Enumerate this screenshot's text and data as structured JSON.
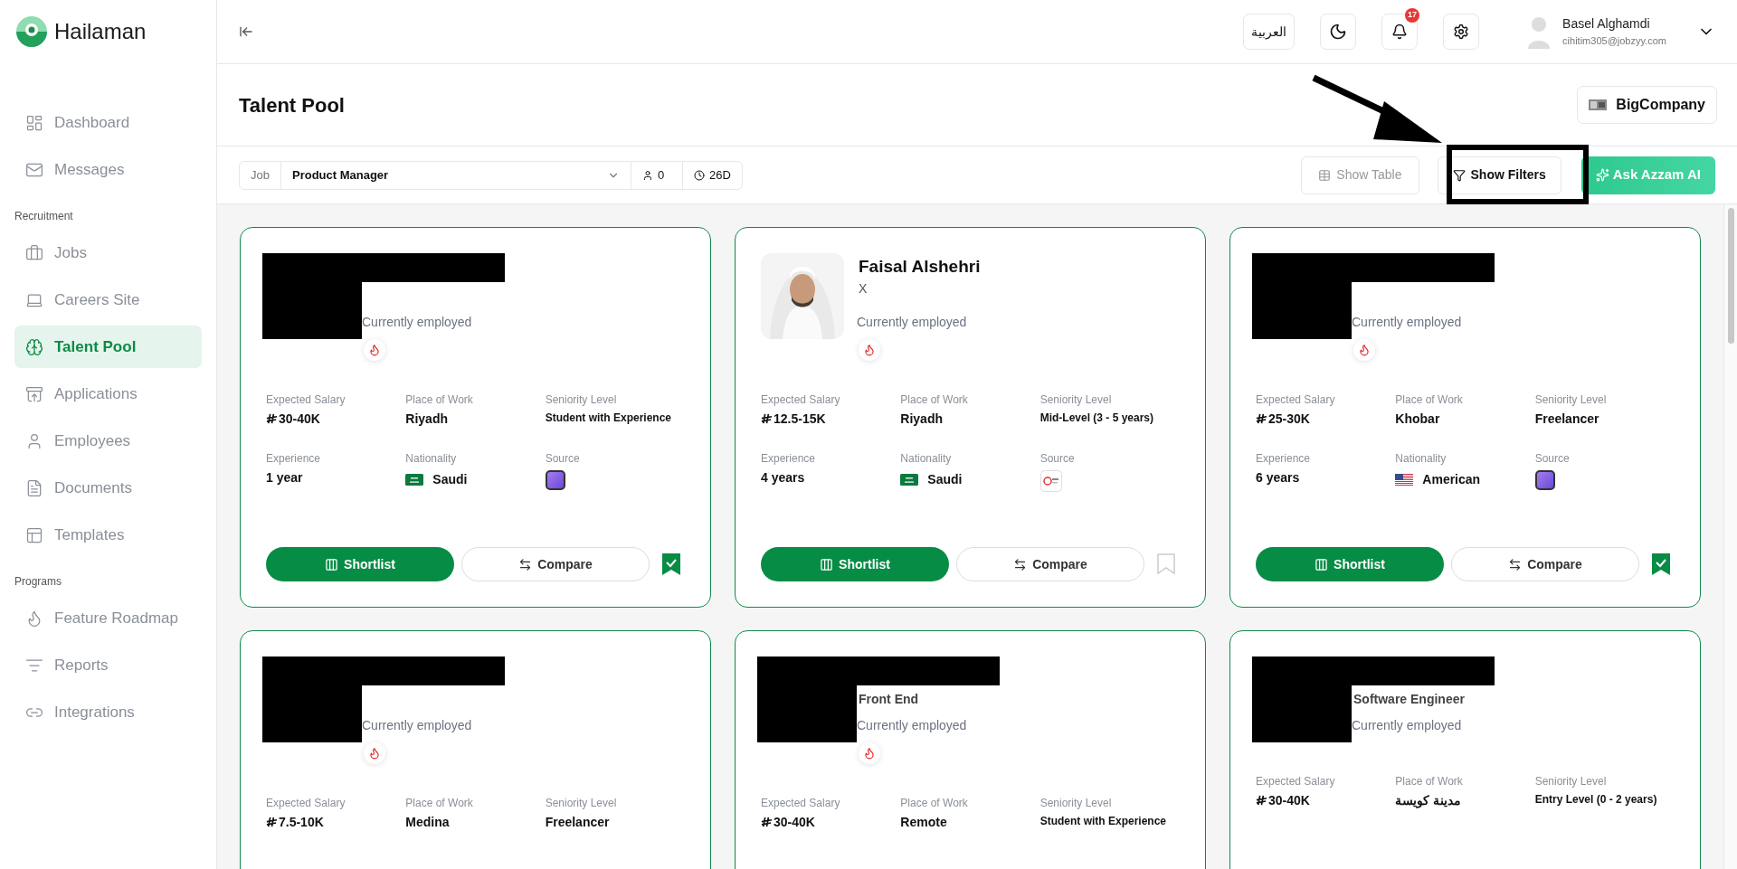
{
  "brand": {
    "name": "Hailaman"
  },
  "sidebar": {
    "sections": [
      {
        "items": [
          {
            "label": "Dashboard",
            "selected": false
          },
          {
            "label": "Messages",
            "selected": false
          }
        ]
      },
      {
        "title": "Recruitment",
        "items": [
          {
            "label": "Jobs",
            "selected": false
          },
          {
            "label": "Careers Site",
            "selected": false
          },
          {
            "label": "Talent Pool",
            "selected": true
          },
          {
            "label": "Applications",
            "selected": false
          },
          {
            "label": "Employees",
            "selected": false
          },
          {
            "label": "Documents",
            "selected": false
          },
          {
            "label": "Templates",
            "selected": false
          }
        ]
      },
      {
        "title": "Programs",
        "items": [
          {
            "label": "Feature Roadmap",
            "selected": false
          },
          {
            "label": "Reports",
            "selected": false
          },
          {
            "label": "Integrations",
            "selected": false
          }
        ]
      }
    ]
  },
  "header": {
    "language": "العربية",
    "notifications": "17",
    "user": {
      "name": "Basel Alghamdi",
      "email": "cihitim305@jobzyy.com"
    }
  },
  "page": {
    "title": "Talent Pool",
    "company": "BigCompany"
  },
  "filters": {
    "job_label": "Job",
    "job": "Product Manager",
    "count": "0",
    "age": "26D",
    "show_table": "Show Table",
    "show_filters": "Show Filters",
    "ask_ai": "Ask Azzam AI"
  },
  "annotation": {
    "highlighted": true
  },
  "cards": [
    {
      "redacted": true,
      "status": "Currently employed",
      "hot": true,
      "bookmarked": true,
      "fields": [
        {
          "kind": "salary",
          "label": "Expected Salary",
          "value": "30-40K"
        },
        {
          "kind": "text",
          "label": "Place of Work",
          "value": "Riyadh"
        },
        {
          "kind": "small",
          "label": "Seniority Level",
          "value": "Student with Experience"
        },
        {
          "kind": "text",
          "label": "Experience",
          "value": "1 year"
        },
        {
          "kind": "flag",
          "label": "Nationality",
          "value": "Saudi",
          "flag": {
            "kind": "sa"
          }
        },
        {
          "kind": "source",
          "label": "Source",
          "source": {
            "kind": "purple"
          }
        }
      ],
      "actions": {
        "shortlist": "Shortlist",
        "compare": "Compare"
      }
    },
    {
      "redacted": false,
      "name": "Faisal Alshehri",
      "title": "X",
      "status": "Currently employed",
      "hot": true,
      "bookmarked": false,
      "fields": [
        {
          "kind": "salary",
          "label": "Expected Salary",
          "value": "12.5-15K"
        },
        {
          "kind": "text",
          "label": "Place of Work",
          "value": "Riyadh"
        },
        {
          "kind": "small",
          "label": "Seniority Level",
          "value": "Mid-Level (3 - 5 years)"
        },
        {
          "kind": "text",
          "label": "Experience",
          "value": "4 years"
        },
        {
          "kind": "flag",
          "label": "Nationality",
          "value": "Saudi",
          "flag": {
            "kind": "sa"
          }
        },
        {
          "kind": "source",
          "label": "Source",
          "source": {
            "kind": "logo"
          }
        }
      ],
      "actions": {
        "shortlist": "Shortlist",
        "compare": "Compare"
      }
    },
    {
      "redacted": true,
      "status": "Currently employed",
      "hot": true,
      "bookmarked": true,
      "fields": [
        {
          "kind": "salary",
          "label": "Expected Salary",
          "value": "25-30K"
        },
        {
          "kind": "text",
          "label": "Place of Work",
          "value": "Khobar"
        },
        {
          "kind": "text",
          "label": "Seniority Level",
          "value": "Freelancer"
        },
        {
          "kind": "text",
          "label": "Experience",
          "value": "6 years"
        },
        {
          "kind": "flag",
          "label": "Nationality",
          "value": "American",
          "flag": {
            "kind": "us"
          }
        },
        {
          "kind": "source",
          "label": "Source",
          "source": {
            "kind": "purple"
          }
        }
      ],
      "actions": {
        "shortlist": "Shortlist",
        "compare": "Compare"
      }
    },
    {
      "redacted": true,
      "status": "Currently employed",
      "hot": true,
      "fields": [
        {
          "kind": "salary",
          "label": "Expected Salary",
          "value": "7.5-10K"
        },
        {
          "kind": "text",
          "label": "Place of Work",
          "value": "Medina"
        },
        {
          "kind": "text",
          "label": "Seniority Level",
          "value": "Freelancer"
        }
      ]
    },
    {
      "redacted": true,
      "title": "Front End",
      "status": "Currently employed",
      "hot": true,
      "fields": [
        {
          "kind": "salary",
          "label": "Expected Salary",
          "value": "30-40K"
        },
        {
          "kind": "text",
          "label": "Place of Work",
          "value": "Remote"
        },
        {
          "kind": "small",
          "label": "Seniority Level",
          "value": "Student with Experience"
        }
      ]
    },
    {
      "redacted": true,
      "title": "Software Engineer",
      "status": "Currently employed",
      "hot": false,
      "fields": [
        {
          "kind": "salary",
          "label": "Expected Salary",
          "value": "30-40K"
        },
        {
          "kind": "text",
          "label": "Place of Work",
          "value": "مدينة كويسة"
        },
        {
          "kind": "small",
          "label": "Seniority Level",
          "value": "Entry Level (0 - 2 years)"
        }
      ]
    }
  ]
}
